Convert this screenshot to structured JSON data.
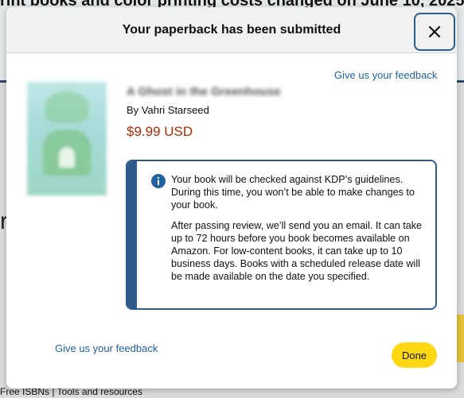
{
  "background": {
    "headline": "rint books and color printing costs changed on June 10, 2025",
    "footer": "Free ISBNs | Tools and resources"
  },
  "modal": {
    "title": "Your paperback has been submitted",
    "close_icon": "close-icon",
    "feedback_link_top": "Give us your feedback",
    "book": {
      "title": "A Ghost in the Greenhouse",
      "byline": "By Vahri Starseed",
      "price": "$9.99 USD"
    },
    "alert": {
      "icon": "info-icon",
      "accent_color": "#2f5b8a",
      "paragraph1": "Your book will be checked against KDP’s guidelines. During this time, you won’t be able to make changes to your book.",
      "paragraph2": "After passing review, we’ll send you an email. It can take up to 72 hours before you book becomes available on Amazon. For low-content books, it can take up to 10 business days. Books with a scheduled release date will be made available on the date you specified."
    },
    "feedback_link_bottom": "Give us your feedback",
    "done_label": "Done",
    "done_color": "#ffd814"
  }
}
